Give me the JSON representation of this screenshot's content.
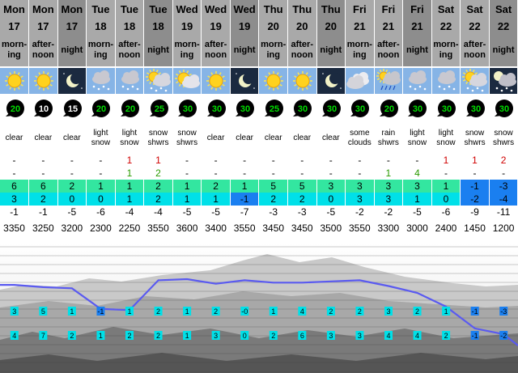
{
  "colors": {
    "header": "#a9a9a9",
    "header_night": "#8d8d8d",
    "max_band": "#33e6a0",
    "min_band": "#00e0e8",
    "cold_band": "#1a7ff0",
    "freeze_line": "#5a5af0",
    "wind_text": "#00dd00"
  },
  "forecast": {
    "columns": [
      {
        "day": "Mon",
        "date": "17",
        "tod": [
          "morn-",
          "ing"
        ],
        "icon": "sun-icon",
        "wind": "20",
        "desc": [
          "clear"
        ],
        "snow": "-",
        "rain": "-",
        "max": "6",
        "min": "3",
        "chill": "-1",
        "fl": "3350",
        "night": false
      },
      {
        "day": "Mon",
        "date": "17",
        "tod": [
          "after-",
          "noon"
        ],
        "icon": "sun-icon",
        "wind": "10",
        "desc": [
          "clear"
        ],
        "snow": "-",
        "rain": "-",
        "max": "6",
        "min": "2",
        "chill": "-1",
        "fl": "3250",
        "night": false
      },
      {
        "day": "Mon",
        "date": "17",
        "tod": [
          "night"
        ],
        "icon": "moon-icon",
        "wind": "15",
        "desc": [
          "clear"
        ],
        "snow": "-",
        "rain": "-",
        "max": "2",
        "min": "0",
        "chill": "-5",
        "fl": "3200",
        "night": true
      },
      {
        "day": "Tue",
        "date": "18",
        "tod": [
          "morn-",
          "ing"
        ],
        "icon": "snow-cloud-icon",
        "wind": "20",
        "desc": [
          "light",
          "snow"
        ],
        "snow": "-",
        "rain": "-",
        "max": "1",
        "min": "0",
        "chill": "-6",
        "fl": "2300",
        "night": false
      },
      {
        "day": "Tue",
        "date": "18",
        "tod": [
          "after-",
          "noon"
        ],
        "icon": "snow-cloud-icon",
        "wind": "20",
        "desc": [
          "light",
          "snow"
        ],
        "snow": "1",
        "rain": "1",
        "max": "1",
        "min": "1",
        "chill": "-4",
        "fl": "2250",
        "night": false
      },
      {
        "day": "Tue",
        "date": "18",
        "tod": [
          "night"
        ],
        "icon": "sun-snow-icon",
        "wind": "25",
        "desc": [
          "snow",
          "shwrs"
        ],
        "snow": "1",
        "rain": "2",
        "max": "2",
        "min": "2",
        "chill": "-4",
        "fl": "3550",
        "night": true
      },
      {
        "day": "Wed",
        "date": "19",
        "tod": [
          "morn-",
          "ing"
        ],
        "icon": "partly-cloudy-icon",
        "wind": "30",
        "desc": [
          "snow",
          "shwrs"
        ],
        "snow": "-",
        "rain": "-",
        "max": "1",
        "min": "1",
        "chill": "-5",
        "fl": "3600",
        "night": false
      },
      {
        "day": "Wed",
        "date": "19",
        "tod": [
          "after-",
          "noon"
        ],
        "icon": "sun-icon",
        "wind": "30",
        "desc": [
          "clear"
        ],
        "snow": "-",
        "rain": "-",
        "max": "2",
        "min": "1",
        "chill": "-5",
        "fl": "3400",
        "night": false
      },
      {
        "day": "Wed",
        "date": "19",
        "tod": [
          "night"
        ],
        "icon": "moon-icon",
        "wind": "30",
        "desc": [
          "clear"
        ],
        "snow": "-",
        "rain": "-",
        "max": "1",
        "min": "-1",
        "chill": "-7",
        "fl": "3550",
        "night": true
      },
      {
        "day": "Thu",
        "date": "20",
        "tod": [
          "morn-",
          "ing"
        ],
        "icon": "sun-icon",
        "wind": "25",
        "desc": [
          "clear"
        ],
        "snow": "-",
        "rain": "-",
        "max": "5",
        "min": "2",
        "chill": "-3",
        "fl": "3450",
        "night": false
      },
      {
        "day": "Thu",
        "date": "20",
        "tod": [
          "after-",
          "noon"
        ],
        "icon": "sun-icon",
        "wind": "30",
        "desc": [
          "clear"
        ],
        "snow": "-",
        "rain": "-",
        "max": "5",
        "min": "2",
        "chill": "-3",
        "fl": "3450",
        "night": false
      },
      {
        "day": "Thu",
        "date": "20",
        "tod": [
          "night"
        ],
        "icon": "moon-icon",
        "wind": "30",
        "desc": [
          "clear"
        ],
        "snow": "-",
        "rain": "-",
        "max": "3",
        "min": "0",
        "chill": "-5",
        "fl": "3500",
        "night": true
      },
      {
        "day": "Fri",
        "date": "21",
        "tod": [
          "morn-",
          "ing"
        ],
        "icon": "cloud-icon",
        "wind": "30",
        "desc": [
          "some",
          "clouds"
        ],
        "snow": "-",
        "rain": "-",
        "max": "3",
        "min": "3",
        "chill": "-2",
        "fl": "3550",
        "night": false
      },
      {
        "day": "Fri",
        "date": "21",
        "tod": [
          "after-",
          "noon"
        ],
        "icon": "rain-cloud-icon",
        "wind": "20",
        "desc": [
          "rain",
          "shwrs"
        ],
        "snow": "-",
        "rain": "1",
        "max": "3",
        "min": "3",
        "chill": "-2",
        "fl": "3300",
        "night": false
      },
      {
        "day": "Fri",
        "date": "21",
        "tod": [
          "night"
        ],
        "icon": "snow-cloud-icon",
        "wind": "30",
        "desc": [
          "light",
          "snow"
        ],
        "snow": "-",
        "rain": "4",
        "max": "3",
        "min": "1",
        "chill": "-5",
        "fl": "3000",
        "night": true
      },
      {
        "day": "Sat",
        "date": "22",
        "tod": [
          "morn-",
          "ing"
        ],
        "icon": "snow-cloud-icon",
        "wind": "30",
        "desc": [
          "light",
          "snow"
        ],
        "snow": "1",
        "rain": "-",
        "max": "1",
        "min": "0",
        "chill": "-6",
        "fl": "2400",
        "night": false
      },
      {
        "day": "Sat",
        "date": "22",
        "tod": [
          "after-",
          "noon"
        ],
        "icon": "sun-snow-icon",
        "wind": "30",
        "desc": [
          "snow",
          "shwrs"
        ],
        "snow": "1",
        "rain": "-",
        "max": "-1",
        "min": "-2",
        "chill": "-9",
        "fl": "1450",
        "night": false
      },
      {
        "day": "Sat",
        "date": "22",
        "tod": [
          "night"
        ],
        "icon": "moon-snow-icon",
        "wind": "30",
        "desc": [
          "snow",
          "shwrs"
        ],
        "snow": "2",
        "rain": "-",
        "max": "-3",
        "min": "-4",
        "chill": "-11",
        "fl": "1200",
        "night": true
      }
    ]
  },
  "mountain_chart": {
    "freeze_levels": [
      3350,
      3250,
      3200,
      2300,
      2250,
      3550,
      3600,
      3400,
      3550,
      3450,
      3450,
      3500,
      3550,
      3300,
      3000,
      2400,
      1450,
      1200
    ],
    "upper_markers": [
      "3",
      "5",
      "1",
      "-1",
      "1",
      "2",
      "1",
      "2",
      "-0",
      "1",
      "4",
      "2",
      "2",
      "3",
      "2",
      "1",
      "-1",
      "-3"
    ],
    "lower_markers": [
      "4",
      "7",
      "2",
      "1",
      "2",
      "2",
      "1",
      "3",
      "0",
      "2",
      "6",
      "3",
      "3",
      "4",
      "4",
      "2",
      "-1",
      "-2"
    ]
  }
}
